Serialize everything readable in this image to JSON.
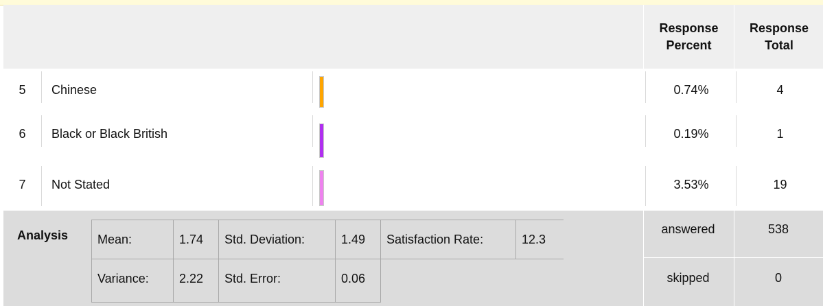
{
  "header": {
    "response_percent_line1": "Response",
    "response_percent_line2": "Percent",
    "response_total_line1": "Response",
    "response_total_line2": "Total"
  },
  "rows": [
    {
      "num": "5",
      "label": "Chinese",
      "percent": "0.74%",
      "total": "4",
      "bar_color": "#ffa500",
      "bar_fraction": 0.0074
    },
    {
      "num": "6",
      "label": "Black or Black British",
      "percent": "0.19%",
      "total": "1",
      "bar_color": "#b02ef0",
      "bar_fraction": 0.0019
    },
    {
      "num": "7",
      "label": "Not Stated",
      "percent": "3.53%",
      "total": "19",
      "bar_color": "#ee82ee",
      "bar_fraction": 0.0353
    }
  ],
  "analysis": {
    "title": "Analysis",
    "mean_label": "Mean:",
    "mean_value": "1.74",
    "std_dev_label": "Std. Deviation:",
    "std_dev_value": "1.49",
    "satisfaction_label": "Satisfaction Rate:",
    "satisfaction_value": "12.3",
    "variance_label": "Variance:",
    "variance_value": "2.22",
    "std_error_label": "Std. Error:",
    "std_error_value": "0.06",
    "answered_label": "answered",
    "answered_value": "538",
    "skipped_label": "skipped",
    "skipped_value": "0"
  }
}
